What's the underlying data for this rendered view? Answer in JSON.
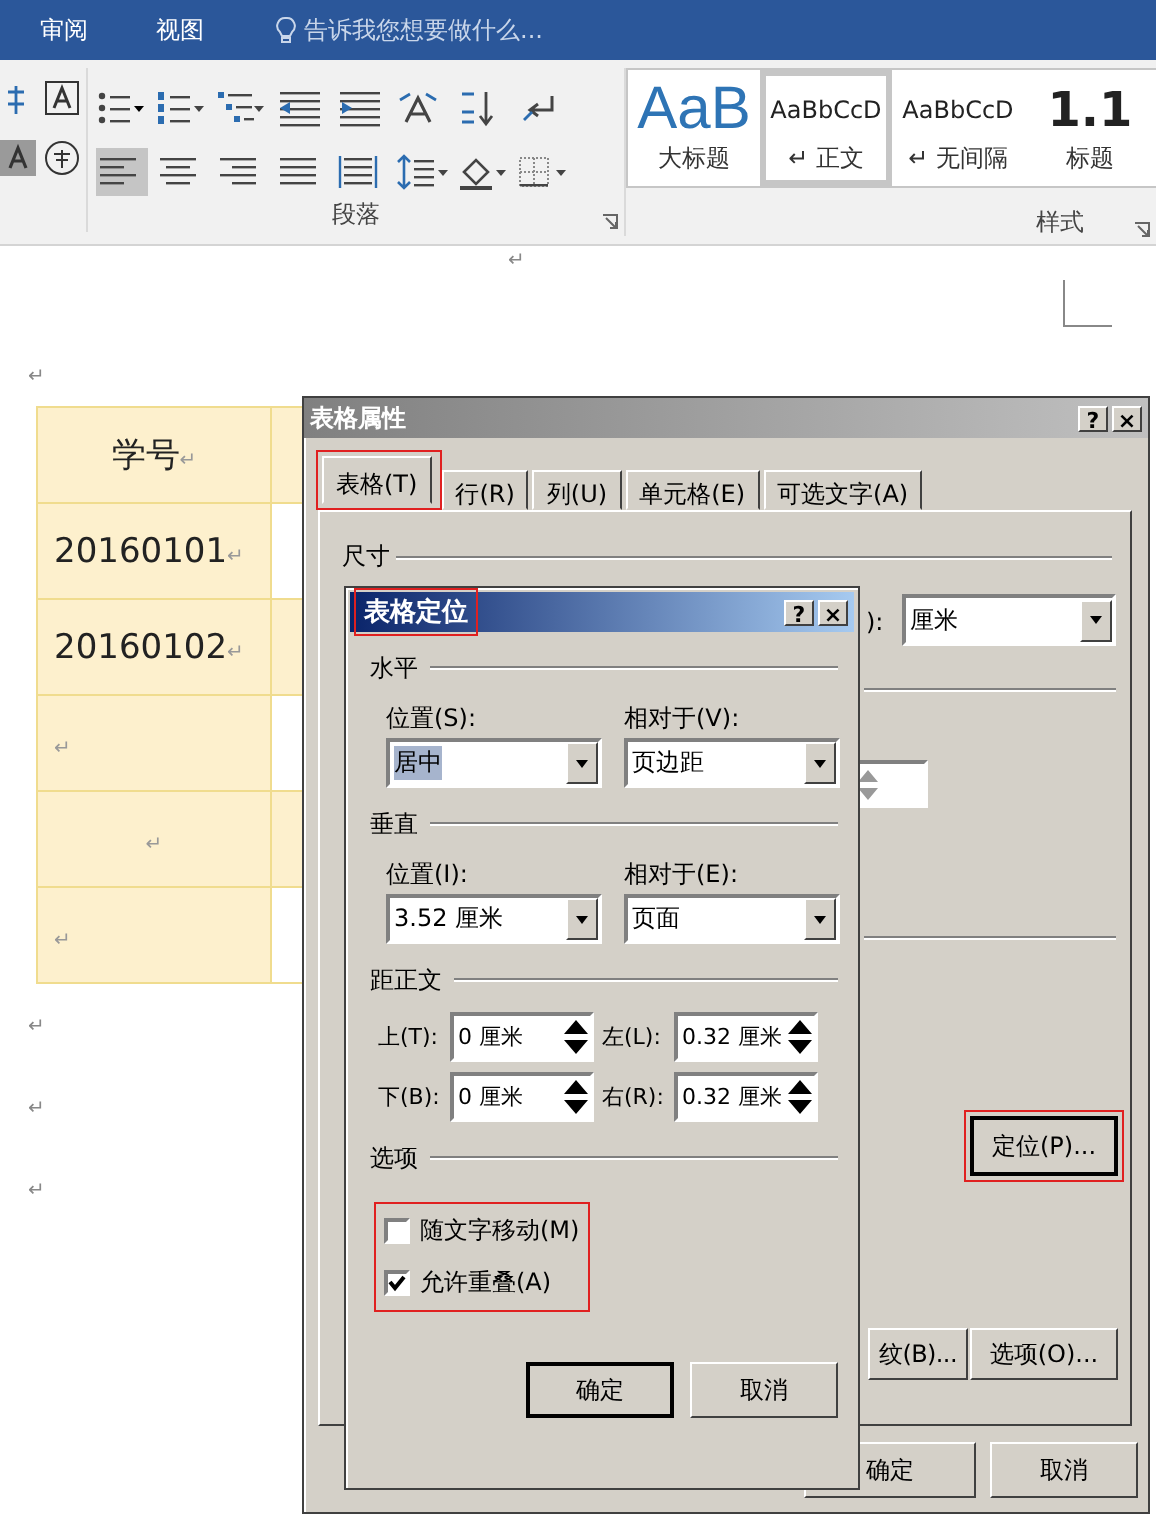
{
  "ribbon_tabs": [
    {
      "label": "审阅"
    },
    {
      "label": "视图"
    }
  ],
  "tell_me": {
    "placeholder": "告诉我您想要做什么..."
  },
  "paragraph_tools": [
    {
      "kind": "bullets",
      "selected": false
    },
    {
      "kind": "numbering",
      "selected": false
    },
    {
      "kind": "multilevel",
      "selected": false
    },
    {
      "kind": "outdent",
      "selected": false
    },
    {
      "kind": "indent",
      "selected": false
    },
    {
      "kind": "charscale",
      "selected": false
    },
    {
      "kind": "sort",
      "selected": false
    },
    {
      "kind": "marks",
      "selected": false
    },
    {
      "kind": "left",
      "selected": true
    },
    {
      "kind": "center",
      "selected": false
    },
    {
      "kind": "right",
      "selected": false
    },
    {
      "kind": "justify",
      "selected": false
    },
    {
      "kind": "distribute",
      "selected": false
    },
    {
      "kind": "spacing",
      "selected": false
    },
    {
      "kind": "shading",
      "selected": false
    },
    {
      "kind": "borders",
      "selected": false
    }
  ],
  "ribbon_groups": [
    {
      "label": "段落"
    },
    {
      "label": "样式"
    }
  ],
  "styles": [
    {
      "kind": "heading",
      "preview": "AaB",
      "label": "大标题",
      "selected": false
    },
    {
      "kind": "normal",
      "preview": "AaBbCcD",
      "label": "↵ 正文",
      "selected": true
    },
    {
      "kind": "normal",
      "preview": "AaBbCcD",
      "label": "↵ 无间隔",
      "selected": false
    },
    {
      "kind": "numbered",
      "preview": "1.1",
      "label": "标题",
      "selected": false
    }
  ],
  "document": {
    "top_mark": "↵",
    "mark_before_table": "↵",
    "table": {
      "rows": [
        {
          "cells": [
            {
              "text": "学号↵",
              "centered": true
            }
          ],
          "column_2_shaded": true
        },
        {
          "cells": [
            {
              "text": "20160101↵",
              "centered": false
            }
          ],
          "column_2_shaded": false
        },
        {
          "cells": [
            {
              "text": "20160102↵",
              "centered": false
            }
          ],
          "column_2_shaded": true
        },
        {
          "cells": [
            {
              "text": "↵",
              "centered": false
            }
          ],
          "column_2_shaded": false
        },
        {
          "cells": [
            {
              "text": "↵",
              "centered": true
            }
          ],
          "column_2_shaded": true
        },
        {
          "cells": [
            {
              "text": "↵",
              "centered": false
            }
          ],
          "column_2_shaded": false
        }
      ]
    },
    "marks_after_table": [
      "↵",
      "↵",
      "↵"
    ]
  },
  "table_properties": {
    "title": "表格属性",
    "help": "?",
    "close": "×",
    "tabs": [
      {
        "label": "表格(T)",
        "selected": true,
        "highlighted": true
      },
      {
        "label": "行(R)",
        "selected": false,
        "highlighted": false
      },
      {
        "label": "列(U)",
        "selected": false,
        "highlighted": false
      },
      {
        "label": "单元格(E)",
        "selected": false,
        "highlighted": false
      },
      {
        "label": "可选文字(A)",
        "selected": false,
        "highlighted": false
      }
    ],
    "size_heading": "尺寸",
    "unit_label": "):",
    "unit_value": "厘米",
    "position_button": {
      "label": "定位(P)...",
      "highlighted": true
    },
    "borders_button": "纹(B)...",
    "options_button": "选项(O)...",
    "buttons": [
      "确定",
      "取消"
    ]
  },
  "table_positioning": {
    "title": "表格定位",
    "help": "?",
    "close": "×",
    "title_highlighted": true,
    "horizontal": {
      "heading": "水平",
      "position_label": "位置(S):",
      "position_value": "居中",
      "relative_label": "相对于(V):",
      "relative_value": "页边距"
    },
    "vertical": {
      "heading": "垂直",
      "position_label": "位置(I):",
      "position_value": "3.52 厘米",
      "relative_label": "相对于(E):",
      "relative_value": "页面"
    },
    "distance": {
      "heading": "距正文",
      "fields": [
        {
          "label": "上(T):",
          "value": "0 厘米"
        },
        {
          "label": "左(L):",
          "value": "0.32 厘米"
        },
        {
          "label": "下(B):",
          "value": "0 厘米"
        },
        {
          "label": "右(R):",
          "value": "0.32 厘米"
        }
      ]
    },
    "options": {
      "heading": "选项",
      "highlighted": true,
      "items": [
        {
          "label": "随文字移动(M)",
          "checked": false
        },
        {
          "label": "允许重叠(A)",
          "checked": true
        }
      ]
    },
    "buttons": [
      {
        "label": "确定",
        "default": true
      },
      {
        "label": "取消",
        "default": false
      }
    ]
  }
}
